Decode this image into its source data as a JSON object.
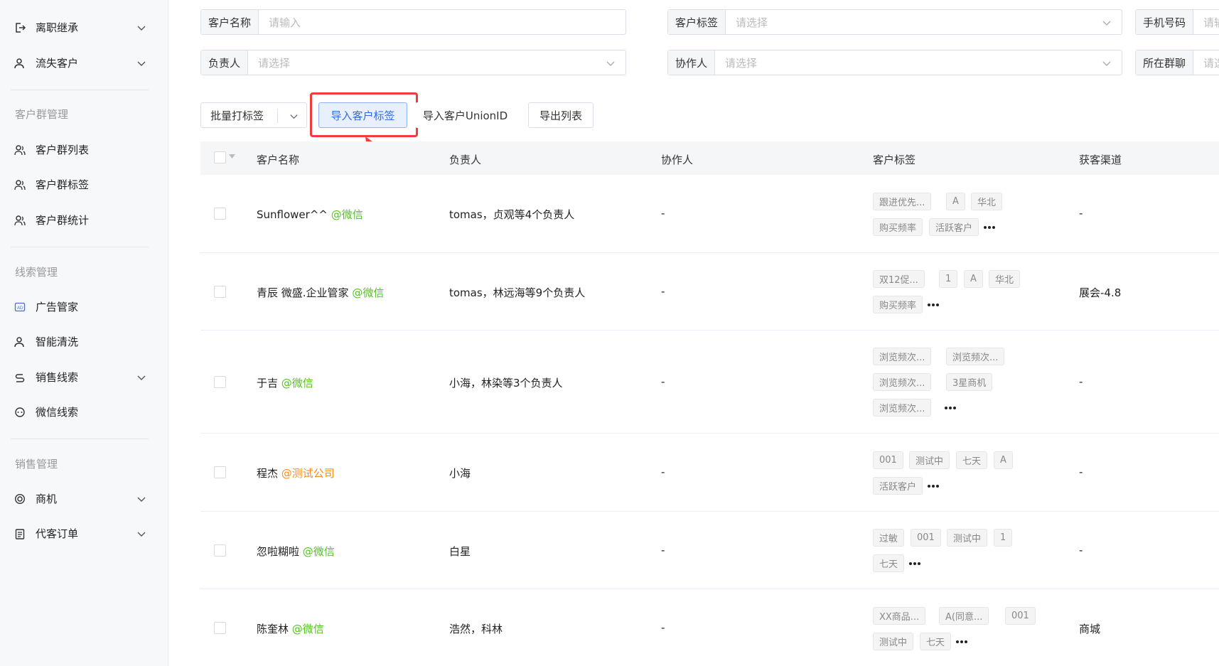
{
  "sidebar": {
    "items": [
      {
        "label": "离职继承",
        "icon": "transfer-icon",
        "expandable": true
      },
      {
        "label": "流失客户",
        "icon": "user-icon",
        "expandable": true
      },
      {
        "label": "客户群列表",
        "icon": "group-icon",
        "expandable": false
      },
      {
        "label": "客户群标签",
        "icon": "group-icon",
        "expandable": false
      },
      {
        "label": "客户群统计",
        "icon": "group-icon",
        "expandable": false
      },
      {
        "label": "广告管家",
        "icon": "ad-icon",
        "expandable": false
      },
      {
        "label": "智能清洗",
        "icon": "user-icon",
        "expandable": false
      },
      {
        "label": "销售线索",
        "icon": "lead-icon",
        "expandable": true
      },
      {
        "label": "微信线索",
        "icon": "wechat-icon",
        "expandable": false
      },
      {
        "label": "商机",
        "icon": "target-icon",
        "expandable": true
      },
      {
        "label": "代客订单",
        "icon": "order-icon",
        "expandable": true
      }
    ],
    "groups": [
      "客户群管理",
      "线索管理",
      "销售管理"
    ]
  },
  "filters": {
    "customer_name": {
      "label": "客户名称",
      "placeholder": "请输入"
    },
    "customer_tag": {
      "label": "客户标签",
      "placeholder": "请选择"
    },
    "phone": {
      "label": "手机号码",
      "placeholder": "请输"
    },
    "owner": {
      "label": "负责人",
      "placeholder": "请选择"
    },
    "collaborator": {
      "label": "协作人",
      "placeholder": "请选择"
    },
    "group_chat": {
      "label": "所在群聊",
      "placeholder": "请选"
    }
  },
  "toolbar": {
    "batch_tag": "批量打标签",
    "import_tags": "导入客户标签",
    "import_unionid": "导入客户UnionID",
    "export": "导出列表"
  },
  "table": {
    "columns": [
      "客户名称",
      "负责人",
      "协作人",
      "客户标签",
      "获客渠道"
    ],
    "rows": [
      {
        "name": "Sunflower^^",
        "source": "@微信",
        "source_type": "wechat",
        "owner": "tomas，贞观等4个负责人",
        "collaborator": "-",
        "tags": [
          [
            "跟进优先...",
            "A",
            "华北"
          ],
          [
            "购买频率",
            "活跃客户"
          ]
        ],
        "channel": "-"
      },
      {
        "name": "青辰 微盛.企业管家",
        "source": "@微信",
        "source_type": "wechat",
        "owner": "tomas，林远海等9个负责人",
        "collaborator": "-",
        "tags": [
          [
            "双12促...",
            "1",
            "A",
            "华北"
          ],
          [
            "购买频率"
          ]
        ],
        "channel": "展会-4.8"
      },
      {
        "name": "于吉",
        "source": "@微信",
        "source_type": "wechat",
        "owner": "小海，林染等3个负责人",
        "collaborator": "-",
        "tags": [
          [
            "浏览频次...",
            "浏览频次..."
          ],
          [
            "浏览频次...",
            "3星商机"
          ],
          [
            "浏览频次..."
          ]
        ],
        "channel": "-"
      },
      {
        "name": "程杰",
        "source": "@测试公司",
        "source_type": "corp",
        "owner": "小海",
        "collaborator": "-",
        "tags": [
          [
            "001",
            "测试中",
            "七天",
            "A"
          ],
          [
            "活跃客户"
          ]
        ],
        "channel": "-"
      },
      {
        "name": "忽啦糊啦",
        "source": "@微信",
        "source_type": "wechat",
        "owner": "白星",
        "collaborator": "-",
        "tags": [
          [
            "过敏",
            "001",
            "测试中",
            "1"
          ],
          [
            "七天"
          ]
        ],
        "channel": "-"
      },
      {
        "name": "陈奎林",
        "source": "@微信",
        "source_type": "wechat",
        "owner": "浩然，科林",
        "collaborator": "-",
        "tags": [
          [
            "XX商品...",
            "A(同意...",
            "001"
          ],
          [
            "测试中",
            "七天"
          ]
        ],
        "channel": "商城"
      }
    ]
  },
  "colors": {
    "accent": "#2f6be6",
    "wechat": "#52c41a",
    "corp": "#fa8c16",
    "highlight": "#f23b3b"
  }
}
